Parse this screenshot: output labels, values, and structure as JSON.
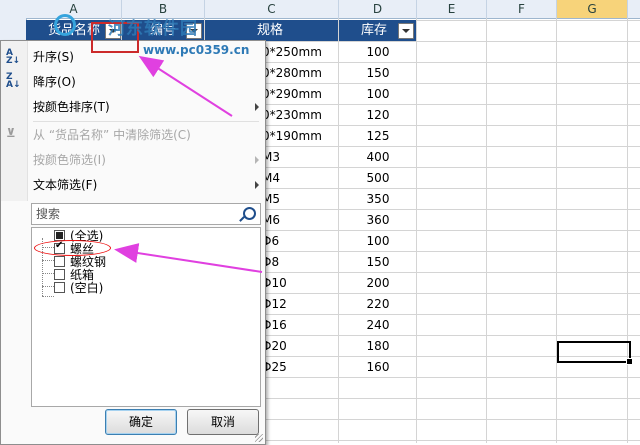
{
  "columns": [
    "A",
    "B",
    "C",
    "D",
    "E",
    "F",
    "G"
  ],
  "table_headers": {
    "a": "货品名称",
    "b": "编号",
    "c": "规格",
    "d": "库存"
  },
  "rows": [
    {
      "c": "0*250mm",
      "d": "100"
    },
    {
      "c": "0*280mm",
      "d": "150"
    },
    {
      "c": "0*290mm",
      "d": "100"
    },
    {
      "c": "0*230mm",
      "d": "120"
    },
    {
      "c": "0*190mm",
      "d": "125"
    },
    {
      "c": "M3",
      "d": "400"
    },
    {
      "c": "M4",
      "d": "500"
    },
    {
      "c": "M5",
      "d": "350"
    },
    {
      "c": "M6",
      "d": "360"
    },
    {
      "c": "Φ6",
      "d": "100"
    },
    {
      "c": "Φ8",
      "d": "150"
    },
    {
      "c": "Φ10",
      "d": "200"
    },
    {
      "c": "Φ12",
      "d": "220"
    },
    {
      "c": "Φ16",
      "d": "240"
    },
    {
      "c": "Φ20",
      "d": "180"
    },
    {
      "c": "Φ25",
      "d": "160"
    }
  ],
  "menu": {
    "sort_asc": "升序(S)",
    "sort_desc": "降序(O)",
    "sort_color": "按颜色排序(T)",
    "clear_filter": "从 “货品名称” 中清除筛选(C)",
    "filter_color": "按颜色筛选(I)",
    "text_filter": "文本筛选(F)"
  },
  "search": {
    "placeholder": "搜索"
  },
  "filter_list": [
    {
      "label": "(全选)",
      "state": "indeterminate"
    },
    {
      "label": "螺丝",
      "state": "checked"
    },
    {
      "label": "螺纹钢",
      "state": "unchecked"
    },
    {
      "label": "纸箱",
      "state": "unchecked"
    },
    {
      "label": "(空白)",
      "state": "unchecked"
    }
  ],
  "buttons": {
    "ok": "确定",
    "cancel": "取消"
  },
  "watermark": {
    "text": "河东软件园",
    "url": "www.pc0359.cn"
  },
  "colors": {
    "table_header": "#1f4e8c",
    "annotation_arrow": "#e040e0",
    "annotation_circle": "#e11111"
  }
}
